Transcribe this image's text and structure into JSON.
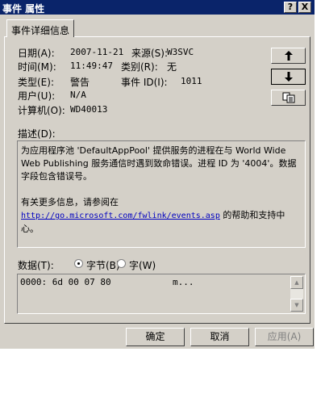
{
  "window": {
    "title": "事件 属性",
    "help_label": "?",
    "close_label": "X"
  },
  "tab": {
    "label": "事件详细信息"
  },
  "fields": {
    "date_label": "日期(A):",
    "date_value": "2007-11-21",
    "source_label": "来源(S):",
    "source_value": "W3SVC",
    "time_label": "时间(M):",
    "time_value": "11:49:47",
    "category_label": "类别(R):",
    "category_value": "无",
    "type_label": "类型(E):",
    "type_value": "警告",
    "event_id_label": "事件 ID(I):",
    "event_id_value": "1011",
    "user_label": "用户(U):",
    "user_value": "N/A",
    "computer_label": "计算机(O):",
    "computer_value": "WD40013"
  },
  "nav": {
    "up_icon": "arrow-up-icon",
    "down_icon": "arrow-down-icon",
    "copy_icon": "copy-icon"
  },
  "description": {
    "label": "描述(D):",
    "line1": "为应用程序池 'DefaultAppPool' 提供服务的进程在与 World Wide Web Publishing 服务通信时遇到致命错误。进程 ID 为 '4004'。数据字段包含错误号。",
    "line2_prefix": "有关更多信息，请参阅在",
    "link": "http://go.microsoft.com/fwlink/events.asp",
    "line2_suffix": "的帮助和支持中心。"
  },
  "data": {
    "label": "数据(T):",
    "bytes_label": "字节(B)",
    "words_label": "字(W)",
    "selected": "bytes",
    "hex_line": "0000: 6d 00 07 80",
    "ascii_line": "m..."
  },
  "buttons": {
    "ok": "确定",
    "cancel": "取消",
    "apply": "应用(A)"
  }
}
